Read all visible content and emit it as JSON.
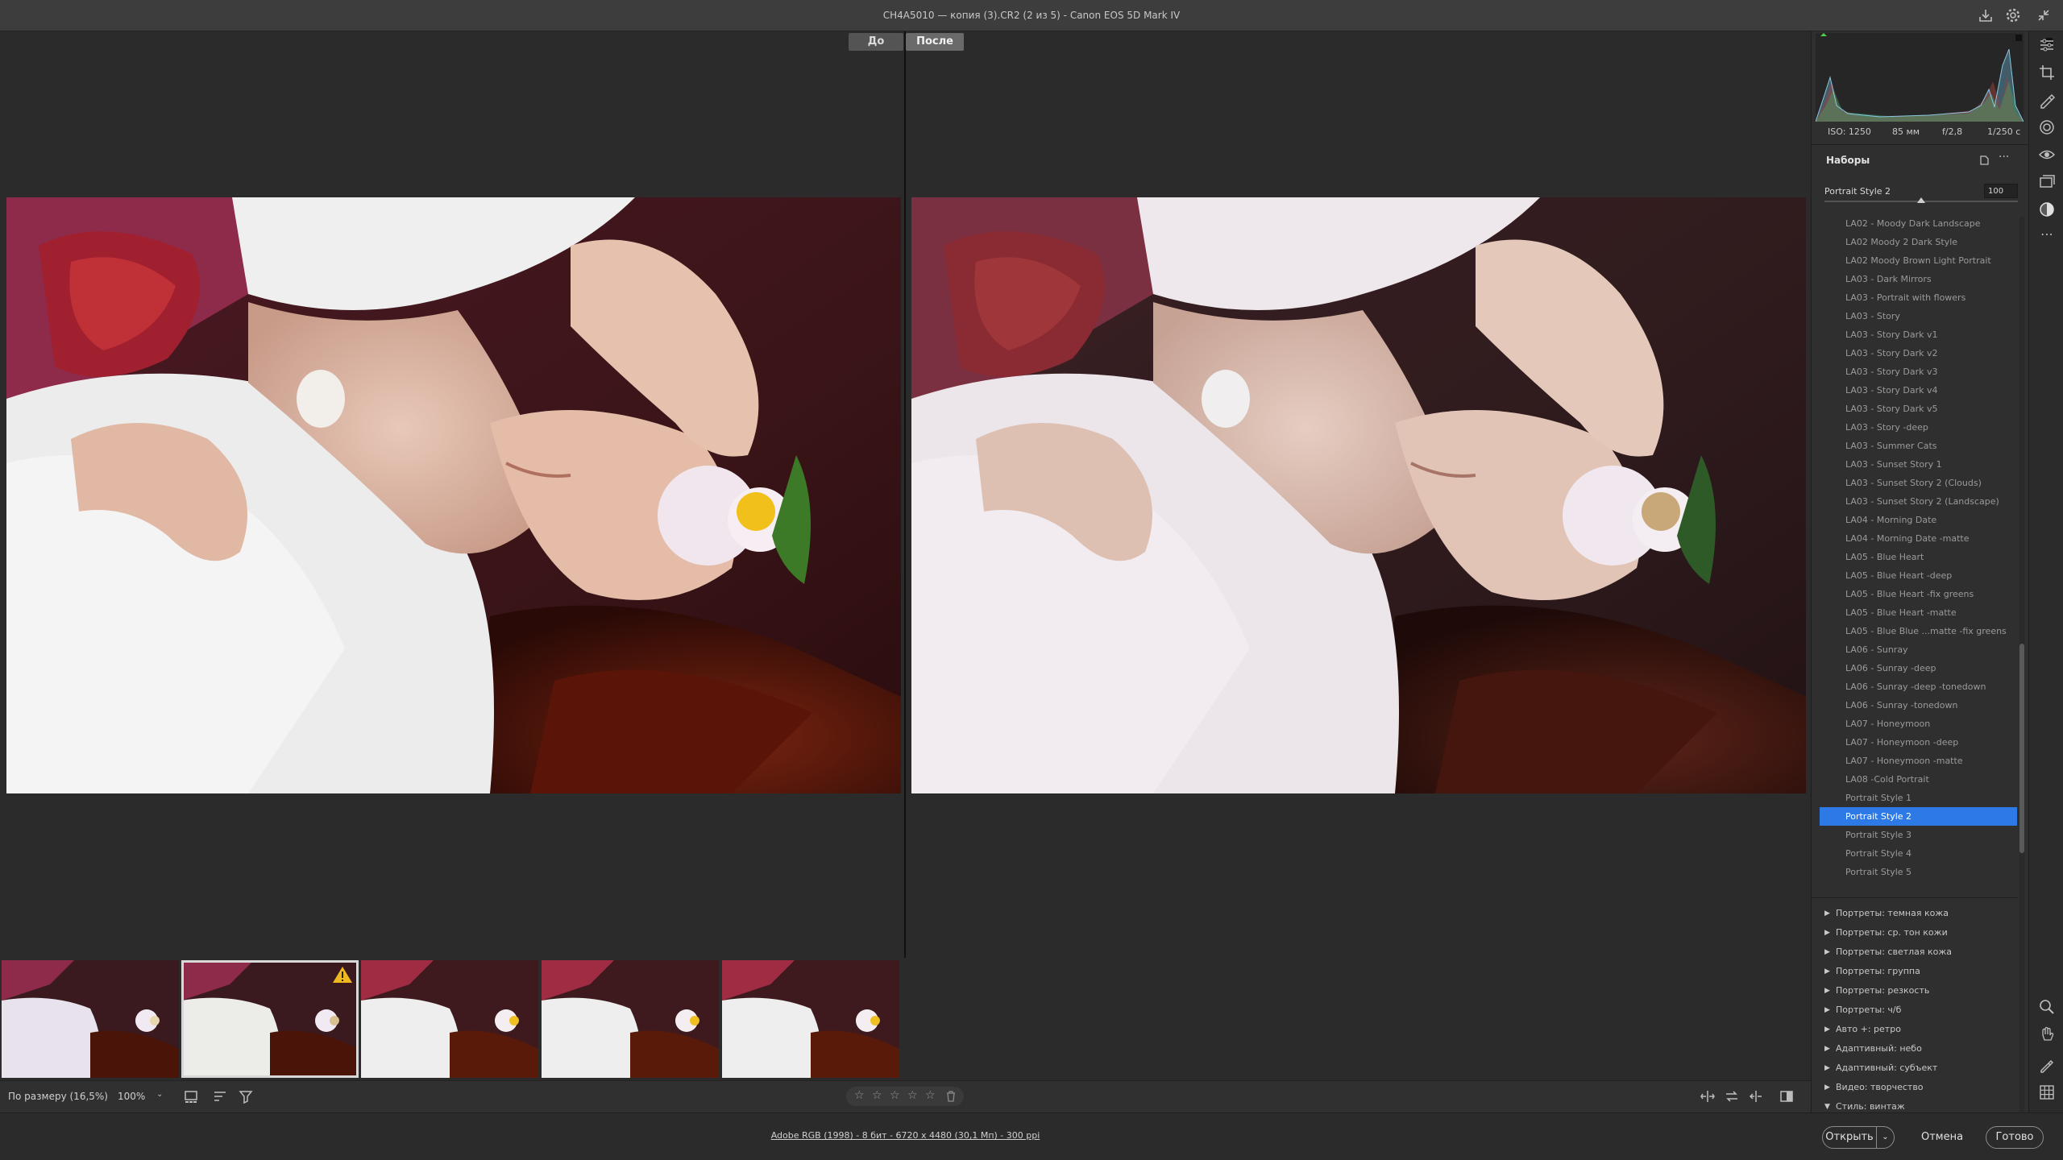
{
  "window": {
    "title": "CH4A5010 — копия (3).CR2 (2 из 5)  -  Canon EOS 5D Mark IV"
  },
  "compare": {
    "before_label": "До",
    "after_label": "После"
  },
  "exif": {
    "iso": "ISO: 1250",
    "focal": "85 мм",
    "aperture": "f/2,8",
    "shutter": "1/250 с"
  },
  "presets_panel": {
    "title": "Наборы",
    "current_preset": "Portrait Style 2",
    "amount": "100",
    "items": [
      "LA02 - Moody Dark Landscape",
      "LA02 Moody 2 Dark Style",
      "LA02 Moody Brown Light Portrait",
      "LA03 - Dark Mirrors",
      "LA03 - Portrait with flowers",
      "LA03 - Story",
      "LA03 - Story Dark v1",
      "LA03 - Story Dark v2",
      "LA03 - Story Dark v3",
      "LA03 - Story Dark v4",
      "LA03 - Story Dark v5",
      "LA03 - Story -deep",
      "LA03 - Summer Cats",
      "LA03 - Sunset Story 1",
      "LA03 - Sunset Story 2 (Clouds)",
      "LA03 - Sunset Story 2 (Landscape)",
      "LA04 - Morning Date",
      "LA04 - Morning Date -matte",
      "LA05 - Blue Heart",
      "LA05 - Blue Heart -deep",
      "LA05 - Blue Heart -fix greens",
      "LA05 - Blue Heart -matte",
      "LA05 - Blue Blue ...matte -fix greens",
      "LA06 - Sunray",
      "LA06 - Sunray -deep",
      "LA06 - Sunray -deep -tonedown",
      "LA06 - Sunray -tonedown",
      "LA07 - Honeymoon",
      "LA07 - Honeymoon -deep",
      "LA07 - Honeymoon -matte",
      "LA08 -Cold Portrait",
      "Portrait Style 1",
      "Portrait Style 2",
      "Portrait Style 3",
      "Portrait Style 4",
      "Portrait Style 5"
    ],
    "groups": [
      "Портреты: темная кожа",
      "Портреты: ср. тон кожи",
      "Портреты: светлая кожа",
      "Портреты: группа",
      "Портреты: резкость",
      "Портреты: ч/б",
      "Авто +: ретро",
      "Адаптивный: небо",
      "Адаптивный: субъект",
      "Видео: творчество",
      "Стиль: винтаж"
    ]
  },
  "bottombar": {
    "fit_label": "По размеру (16,5%)",
    "zoom_label": "100%"
  },
  "statusbar": {
    "info": "Adobe RGB (1998) - 8 бит - 6720 x 4480 (30,1 Мп) - 300 ppi",
    "open_label": "Открыть",
    "cancel_label": "Отмена",
    "done_label": "Готово"
  },
  "colors": {
    "accent": "#2d7ae6",
    "panel": "#2f2f2f"
  }
}
